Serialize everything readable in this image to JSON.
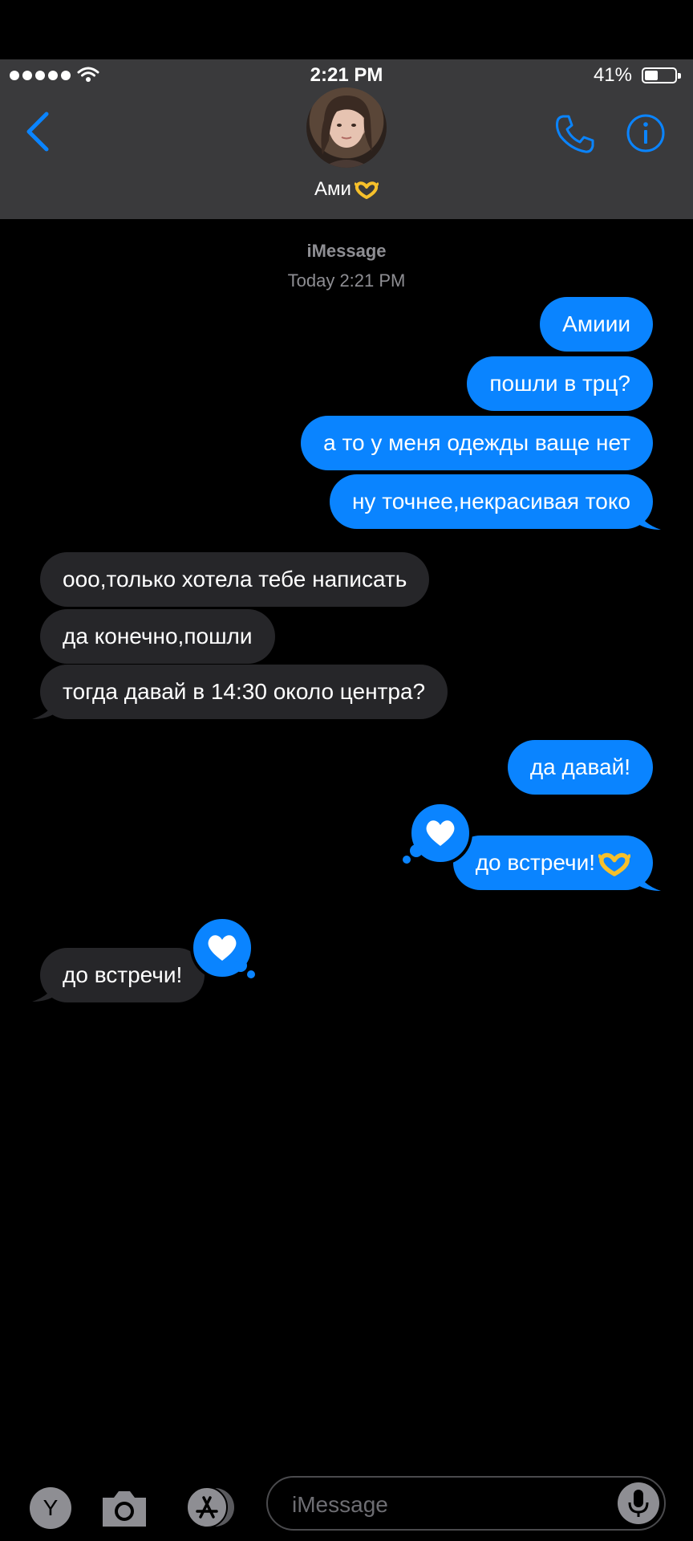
{
  "status_bar": {
    "time": "2:21 PM",
    "battery_percent": "41%",
    "battery_level": 0.41
  },
  "header": {
    "contact_name": "Ами",
    "contact_emoji": "heart-hands-emoji",
    "back_icon": "chevron-left-icon",
    "phone_icon": "phone-icon",
    "info_icon": "info-icon"
  },
  "thread": {
    "service": "iMessage",
    "timestamp": "Today 2:21 PM"
  },
  "messages": [
    {
      "from": "me",
      "text": "Амиии"
    },
    {
      "from": "me",
      "text": "пошли в трц?"
    },
    {
      "from": "me",
      "text": "а то у меня одежды ваще нет"
    },
    {
      "from": "me",
      "text": "ну точнее,некрасивая токо"
    },
    {
      "from": "them",
      "text": "ооо,только хотела тебе написать"
    },
    {
      "from": "them",
      "text": "да конечно,пошли"
    },
    {
      "from": "them",
      "text": "тогда давай в 14:30 около центра?"
    },
    {
      "from": "me",
      "text": "да давай!"
    },
    {
      "from": "me",
      "text": "до встречи!",
      "emoji": "heart-hands-emoji",
      "reaction": "heart"
    },
    {
      "from": "them",
      "text": "до встречи!",
      "reaction": "heart"
    }
  ],
  "input": {
    "placeholder": "iMessage",
    "app_button": "Y"
  },
  "colors": {
    "accent": "#0a84ff",
    "header_bg": "#3a3a3c",
    "received_bubble": "#262629",
    "secondary_text": "#8e8e93"
  }
}
